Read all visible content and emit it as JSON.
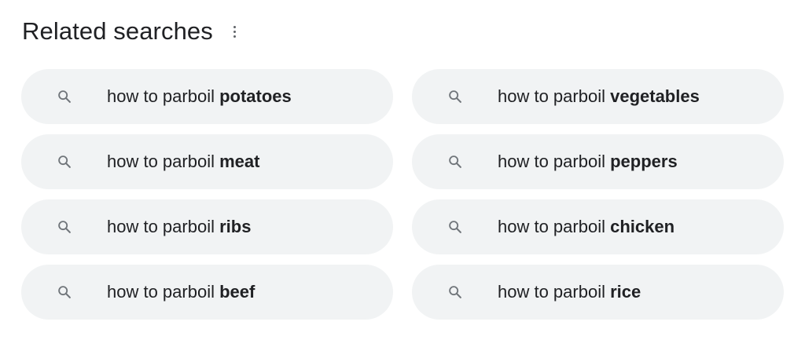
{
  "header": {
    "title": "Related searches",
    "more_icon": "more-vert-icon"
  },
  "related": [
    {
      "prefix": "how to parboil ",
      "bold": "potatoes"
    },
    {
      "prefix": "how to parboil ",
      "bold": "vegetables"
    },
    {
      "prefix": "how to parboil ",
      "bold": "meat"
    },
    {
      "prefix": "how to parboil ",
      "bold": "peppers"
    },
    {
      "prefix": "how to parboil ",
      "bold": "ribs"
    },
    {
      "prefix": "how to parboil ",
      "bold": "chicken"
    },
    {
      "prefix": "how to parboil ",
      "bold": "beef"
    },
    {
      "prefix": "how to parboil ",
      "bold": "rice"
    }
  ],
  "chip_icon": "search-icon",
  "colors": {
    "chip_background": "#f1f3f4",
    "text": "#202124",
    "icon": "#70757a"
  }
}
